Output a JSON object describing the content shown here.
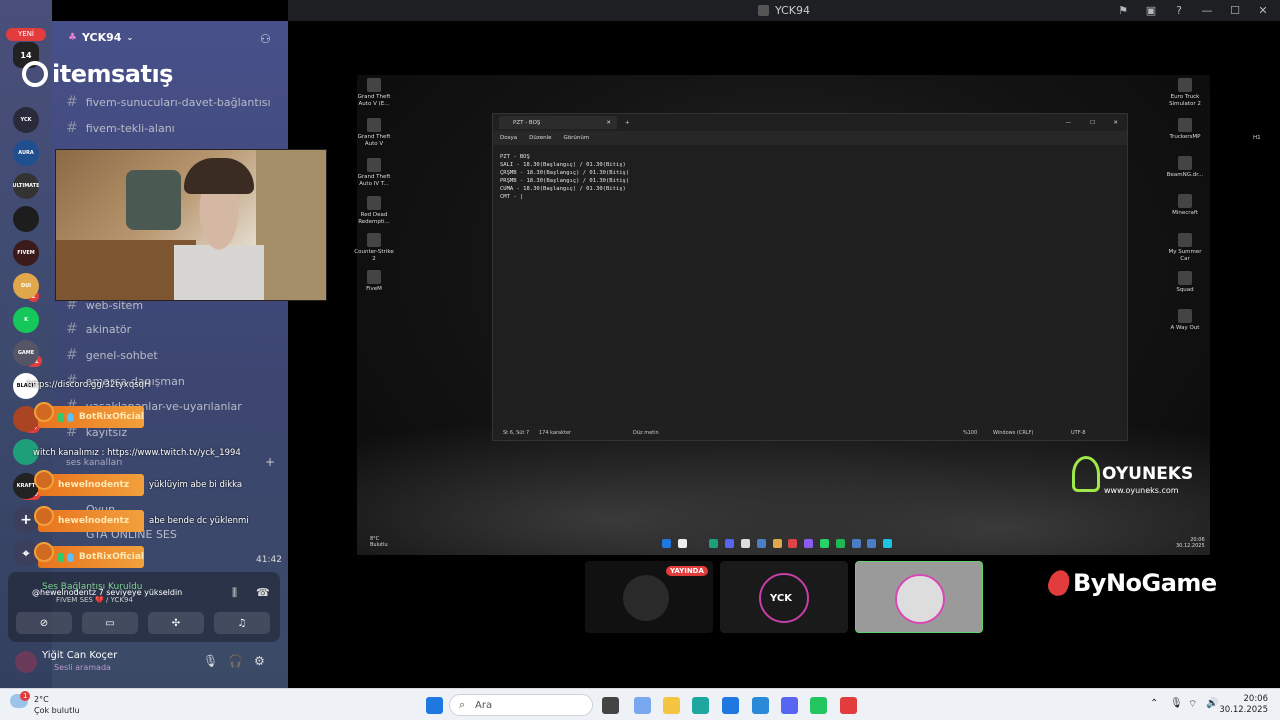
{
  "window": {
    "title": "YCK94"
  },
  "sidebar_badge": "YENİ",
  "servers": [
    {
      "label": "YCK",
      "color": "#2a2a3a"
    },
    {
      "label": "AURA",
      "color": "#1f4f8f"
    },
    {
      "label": "ULTIMATE",
      "color": "#333"
    },
    {
      "label": "",
      "color": "#1d1d1d"
    },
    {
      "label": "FIVEM",
      "color": "#3a1a1a"
    },
    {
      "label": "DUI",
      "color": "#e0a84a"
    },
    {
      "label": "K",
      "color": "#16c75b"
    },
    {
      "label": "GAME",
      "color": "#556"
    },
    {
      "label": "BLACK",
      "color": "#fff"
    },
    {
      "label": "",
      "color": "#a42"
    },
    {
      "label": "",
      "color": "#1f9e7a"
    },
    {
      "label": "KRAFT",
      "color": "#222"
    }
  ],
  "server_badges": [
    "1",
    "11",
    "14",
    "259"
  ],
  "server_name": "YCK94",
  "channels": [
    {
      "name": "fivem-sunucuları-davet-bağlantısı"
    },
    {
      "name": "fivem-tekli-alanı"
    },
    {
      "name": "web-sitem"
    },
    {
      "name": "akinatör"
    },
    {
      "name": "genel-sohbet"
    },
    {
      "name": "amarsa-danışman"
    },
    {
      "name": "yasaklananlar-ve-uyarılanlar"
    },
    {
      "name": "kayıtsız"
    }
  ],
  "voice_category": "ses kanalları",
  "voice_channels": [
    {
      "name": "Oyun"
    },
    {
      "name": "GTA ONLINE SES"
    }
  ],
  "brand_logo": {
    "text": "itemsatış"
  },
  "chat": {
    "lines": [
      {
        "text": "https://discord.gg/32tyxqsqH"
      },
      {
        "text": "witch kanalımız : https://www.twitch.tv/yck_1994"
      }
    ],
    "messages": [
      {
        "user": "BotRixOficial",
        "text": ""
      },
      {
        "user": "hewelnodentz",
        "text": "yüklüyim abe bi dikka"
      },
      {
        "user": "hewelnodentz",
        "text": "abe bende dc yüklenmi"
      },
      {
        "user": "BotRixOficial",
        "text": ""
      }
    ]
  },
  "voice_panel": {
    "status": "Ses Bağlantısı Kuruldu",
    "levelup": "@hewelnodentz 7 seviyeye yükseldin",
    "channel": "FIVEM SES 💔 / YCK94",
    "timer": "41:42"
  },
  "user": {
    "name": "Yiğit Can Koçer",
    "status": "Sesli aramada"
  },
  "stream_desktop": {
    "left_icons": [
      "Grand Theft Auto V (E...",
      "Grand Theft Auto V",
      "Grand Theft Auto IV T...",
      "Red Dead Redempti...",
      "Counter-Strike 2",
      "FiveM"
    ],
    "right_icons": [
      "Euro Truck Simulator 2",
      "TruckersMP",
      "BeamNG.dr...",
      "Minecraft",
      "My Summer Car",
      "Squad",
      "A Way Out"
    ]
  },
  "notepad": {
    "tab": "PZT - BOŞ",
    "menu": [
      "Dosya",
      "Düzenle",
      "Görünüm"
    ],
    "heading_button": "H1",
    "lines": [
      "PZT - BOŞ",
      "SALI - 18.30(Başlangıç) / 01.30(Bitiş)",
      "ÇRŞMB - 18.30(Başlangıç) / 01.30(Bitiş)",
      "PRŞMB - 18.30(Başlangıç) / 01.30(Bitiş)",
      "CUMA - 18.30(Başlangıç) / 01.30(Bitiş)",
      "CMT - |"
    ],
    "status": {
      "position": "St 6, Süt 7",
      "chars": "174 karakter",
      "format": "Düz metin",
      "zoom": "%100",
      "eol": "Windows (CRLF)",
      "encoding": "UTF-8"
    }
  },
  "stream_taskbar": {
    "weather": "8°C",
    "weather_desc": "Bulutlu",
    "time": "20:06",
    "date": "30.12.2025"
  },
  "oyuneks": {
    "name": "OYUNEKS",
    "url": "www.oyuneks.com"
  },
  "bynogame": {
    "name": "ByNoGame"
  },
  "tiles": [
    {
      "label": "YAYINDA",
      "avatar": "#333"
    },
    {
      "label": "YCK",
      "avatar": "#a23a8a"
    },
    {
      "label": "",
      "avatar": "#c8c8c8"
    }
  ],
  "taskbar": {
    "weather_temp": "2°C",
    "weather_desc": "Çok bulutlu",
    "weather_badge": "1",
    "search_placeholder": "Ara",
    "time": "20:06",
    "date": "30.12.2025"
  },
  "accent": "#5865f2",
  "live_color": "#e23c3c"
}
